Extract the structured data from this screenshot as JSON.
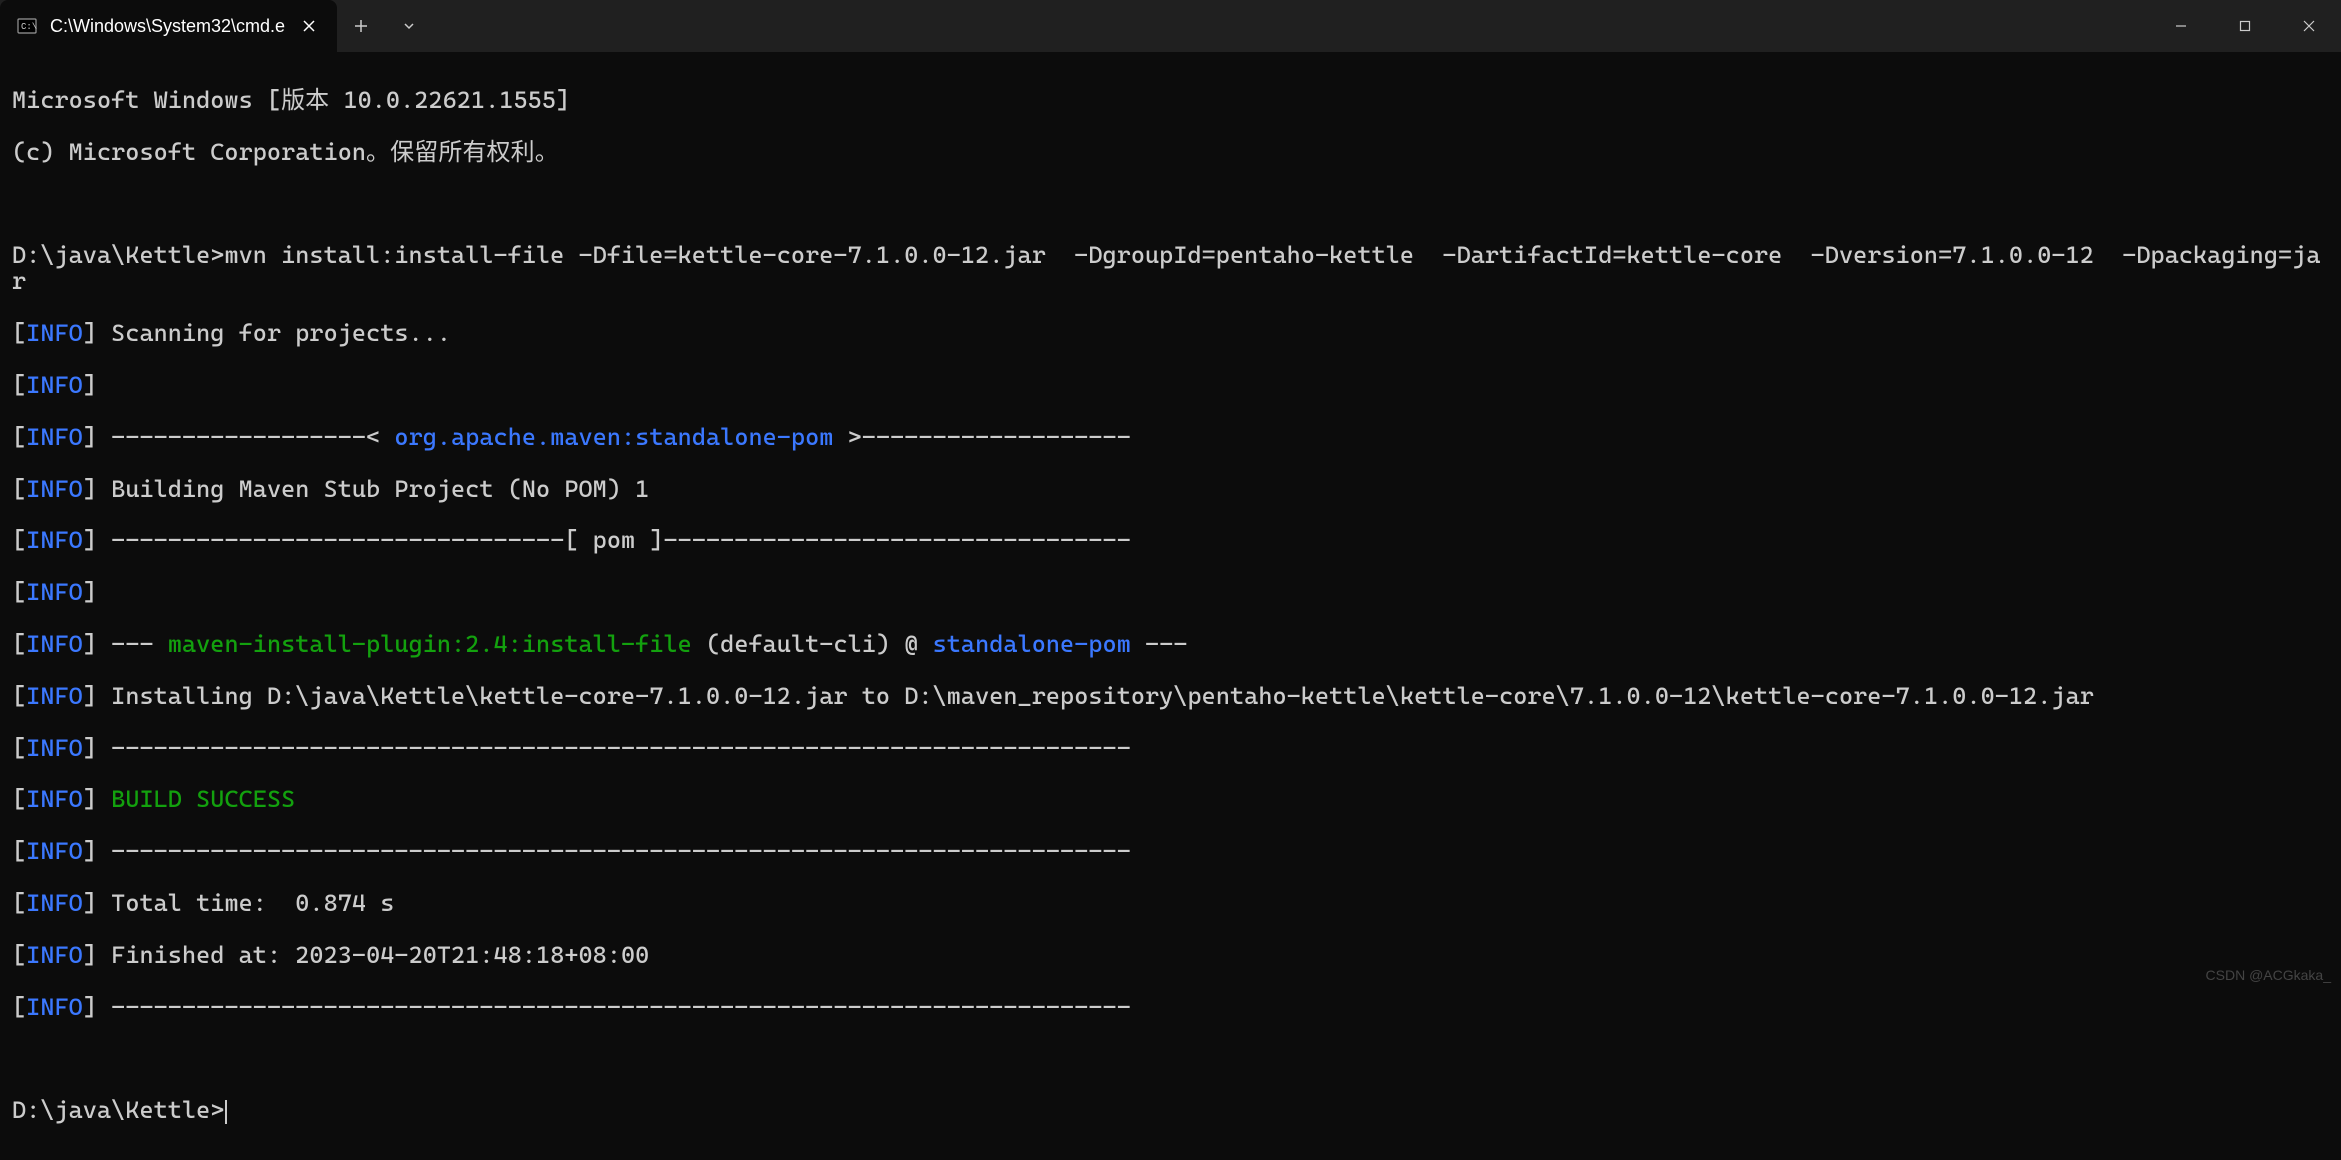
{
  "titlebar": {
    "tab_title": "C:\\Windows\\System32\\cmd.e",
    "close_tab_aria": "Close tab",
    "new_tab_aria": "New tab",
    "dropdown_aria": "Tab options"
  },
  "window_controls": {
    "minimize_aria": "Minimize",
    "maximize_aria": "Maximize",
    "close_aria": "Close"
  },
  "terminal": {
    "banner_line1": "Microsoft Windows [版本 10.0.22621.1555]",
    "banner_line2": "(c) Microsoft Corporation。保留所有权利。",
    "blank": "",
    "prompt1": "D:\\java\\Kettle>",
    "command": "mvn install:install-file -Dfile=kettle-core-7.1.0.0-12.jar  -DgroupId=pentaho-kettle  -DartifactId=kettle-core  -Dversion=7.1.0.0-12  -Dpackaging=jar",
    "info_label": "INFO",
    "scanning": " Scanning for projects...",
    "dash_before_pom": " ------------------< ",
    "pom_artifact": "org.apache.maven:standalone-pom",
    "dash_after_pom": " >-------------------",
    "building": " Building Maven Stub Project (No POM) 1",
    "dash_pom_line": " --------------------------------[ pom ]---------------------------------",
    "plugin_dash_pre": " --- ",
    "plugin_name": "maven-install-plugin:2.4:install-file",
    "plugin_default": " (default-cli) @ ",
    "standalone_pom": "standalone-pom",
    "plugin_dash_post": " ---",
    "installing": " Installing D:\\java\\Kettle\\kettle-core-7.1.0.0-12.jar to D:\\maven_repository\\pentaho-kettle\\kettle-core\\7.1.0.0-12\\kettle-core-7.1.0.0-12.jar",
    "sep_line": " ------------------------------------------------------------------------",
    "build_success": " BUILD SUCCESS",
    "total_time": " Total time:  0.874 s",
    "finished_at": " Finished at: 2023-04-20T21:48:18+08:00",
    "prompt2": "D:\\java\\Kettle>",
    "bracket_open": "[",
    "bracket_close": "]"
  },
  "watermark": "CSDN @ACGkaka_"
}
